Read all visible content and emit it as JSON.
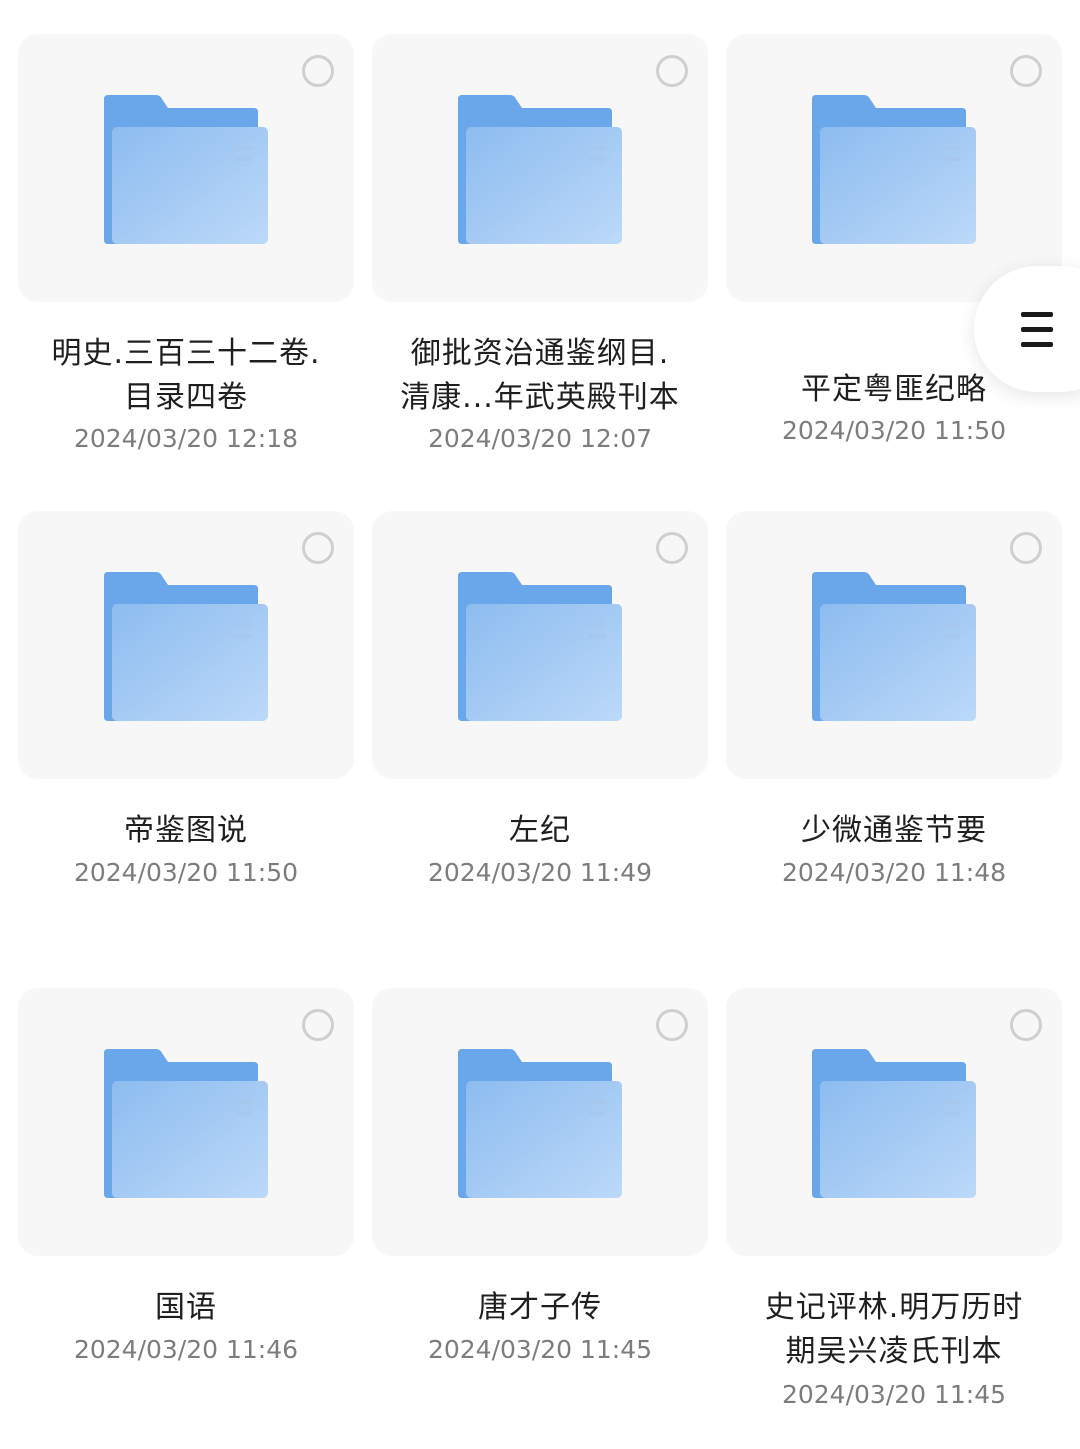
{
  "files": [
    {
      "name": "明史.三百三十二卷.\n目录四卷",
      "date": "2024/03/20 12:18",
      "icon": "folder-icon"
    },
    {
      "name": "御批资治通鉴纲目.\n清康...年武英殿刊本",
      "date": "2024/03/20 12:07",
      "icon": "folder-icon"
    },
    {
      "name": "平定粤匪纪略",
      "date": "2024/03/20 11:50",
      "icon": "folder-icon"
    },
    {
      "name": "帝鉴图说",
      "date": "2024/03/20 11:50",
      "icon": "folder-icon"
    },
    {
      "name": "左纪",
      "date": "2024/03/20 11:49",
      "icon": "folder-icon"
    },
    {
      "name": "少微通鉴节要",
      "date": "2024/03/20 11:48",
      "icon": "folder-icon"
    },
    {
      "name": "国语",
      "date": "2024/03/20 11:46",
      "icon": "folder-icon"
    },
    {
      "name": "唐才子传",
      "date": "2024/03/20 11:45",
      "icon": "folder-icon"
    },
    {
      "name": "史记评林.明万历时\n期吴兴凌氏刊本",
      "date": "2024/03/20 11:45",
      "icon": "folder-icon"
    }
  ],
  "menu_button": {
    "icon": "hamburger-menu-icon"
  },
  "colors": {
    "card_bg": "#f7f7f7",
    "folder_back": "#6aa6ea",
    "folder_front_light": "#b8d6f7",
    "folder_front_dark": "#86b6ef",
    "selection_circle": "#cfcfcf",
    "text_primary": "#1f1f1f",
    "text_secondary": "#7d7d7d"
  }
}
